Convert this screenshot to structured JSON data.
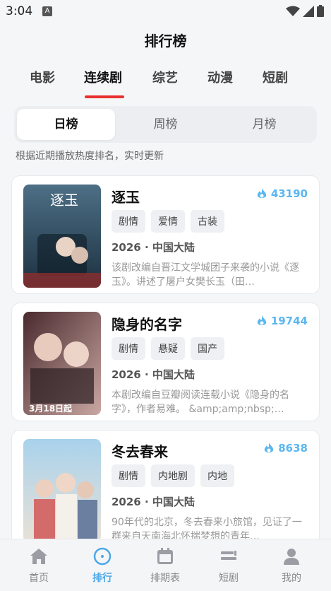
{
  "status": {
    "time": "3:04",
    "notif_letter": "A"
  },
  "header": {
    "title": "排行榜"
  },
  "category_tabs": [
    {
      "label": "电影",
      "active": false
    },
    {
      "label": "连续剧",
      "active": true
    },
    {
      "label": "综艺",
      "active": false
    },
    {
      "label": "动漫",
      "active": false
    },
    {
      "label": "短剧",
      "active": false
    }
  ],
  "period_tabs": [
    {
      "label": "日榜",
      "active": true
    },
    {
      "label": "周榜",
      "active": false
    },
    {
      "label": "月榜",
      "active": false
    }
  ],
  "subtitle": "根据近期播放热度排名，实时更新",
  "items": [
    {
      "title": "逐玉",
      "heat": "43190",
      "tags": [
        "剧情",
        "爱情",
        "古装"
      ],
      "meta": "2026 · 中国大陆",
      "desc": "该剧改编自晋江文学城团子来袭的小说《逐玉》。讲述了屠户女樊长玉（田…",
      "poster_text": "逐玉"
    },
    {
      "title": "隐身的名字",
      "heat": "19744",
      "tags": [
        "剧情",
        "悬疑",
        "国产"
      ],
      "meta": "2026 · 中国大陆",
      "desc": "本剧改编自豆瓣阅读连载小说《隐身的名字》，作者易难。 &amp;amp;nbsp;…",
      "poster_text": "3月18日起"
    },
    {
      "title": "冬去春来",
      "heat": "8638",
      "tags": [
        "剧情",
        "内地剧",
        "内地"
      ],
      "meta": "2026 · 中国大陆",
      "desc": "90年代的北京，冬去春来小旅馆，见证了一群来自天南海北怀揣梦想的青年…",
      "poster_text": ""
    }
  ],
  "bottom_nav": [
    {
      "label": "首页",
      "icon": "home-icon",
      "active": false
    },
    {
      "label": "排行",
      "icon": "ranking-icon",
      "active": true
    },
    {
      "label": "排期表",
      "icon": "calendar-icon",
      "active": false
    },
    {
      "label": "短剧",
      "icon": "short-drama-icon",
      "active": false
    },
    {
      "label": "我的",
      "icon": "profile-icon",
      "active": false
    }
  ],
  "colors": {
    "accent_red": "#e8312f",
    "accent_blue": "#4aa8e8",
    "heat_blue": "#5bb7f0"
  }
}
